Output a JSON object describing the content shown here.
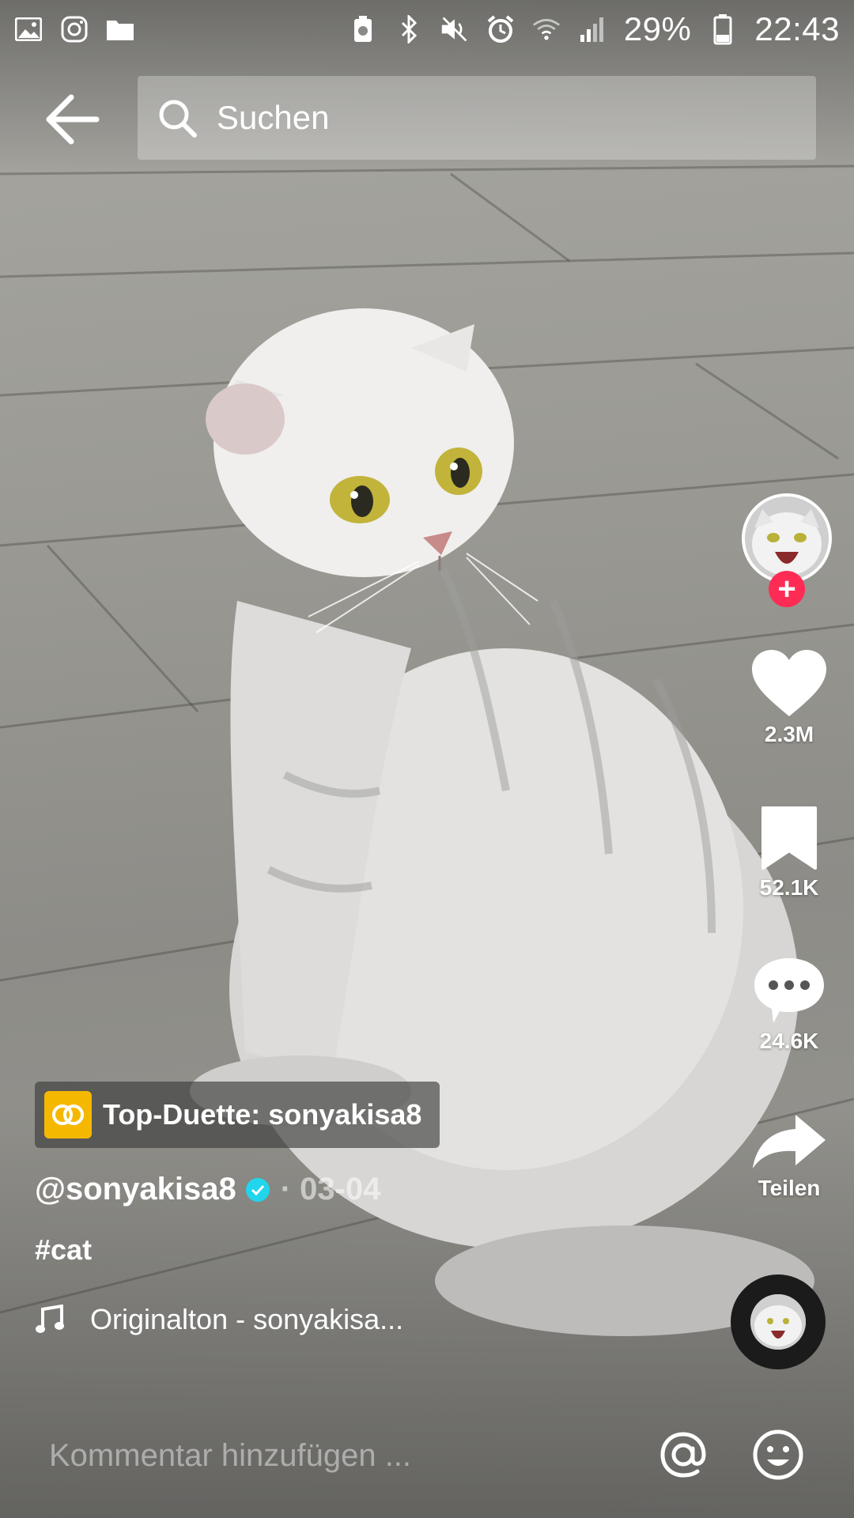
{
  "status_bar": {
    "battery_percent": "29%",
    "time": "22:43",
    "left_icons": [
      "gallery-icon",
      "instagram-icon",
      "folder-icon"
    ],
    "right_icons": [
      "battery-saver-icon",
      "bluetooth-icon",
      "mute-icon",
      "alarm-icon",
      "wifi-icon",
      "signal-icon",
      "battery-icon"
    ]
  },
  "header": {
    "search_placeholder": "Suchen"
  },
  "actions": {
    "likes": "2.3M",
    "saves": "52.1K",
    "comments": "24.6K",
    "share_label": "Teilen"
  },
  "post": {
    "duet_label": "Top-Duette: sonyakisa8",
    "author": "@sonyakisa8",
    "date": "· 03-04",
    "caption": "#cat",
    "sound": "Originalton - sonyakisa..."
  },
  "comment": {
    "placeholder": "Kommentar hinzufügen ..."
  },
  "colors": {
    "follow_accent": "#fe2c55",
    "verified": "#20d5ec",
    "duet_badge": "#f5b800"
  }
}
